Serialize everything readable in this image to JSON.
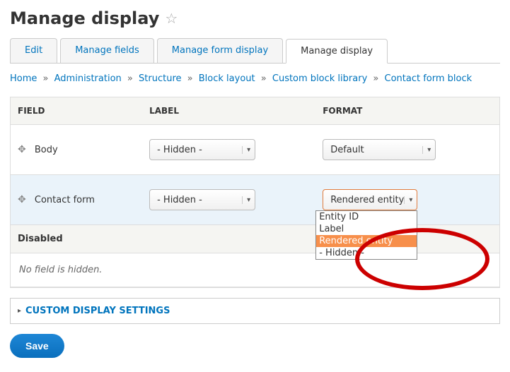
{
  "page": {
    "title": "Manage display"
  },
  "tabs": [
    {
      "label": "Edit"
    },
    {
      "label": "Manage fields"
    },
    {
      "label": "Manage form display"
    },
    {
      "label": "Manage display"
    }
  ],
  "breadcrumb": {
    "items": [
      "Home",
      "Administration",
      "Structure",
      "Block layout",
      "Custom block library",
      "Contact form block"
    ],
    "sep": "»"
  },
  "table": {
    "headers": {
      "field": "FIELD",
      "label": "LABEL",
      "format": "FORMAT"
    },
    "rows": [
      {
        "field": "Body",
        "label_select": "- Hidden -",
        "format_select": "Default"
      },
      {
        "field": "Contact form",
        "label_select": "- Hidden -",
        "format_select": "Rendered entity"
      }
    ]
  },
  "dropdown": {
    "options": [
      "Entity ID",
      "Label",
      "Rendered entity",
      "- Hidden -"
    ]
  },
  "disabled": {
    "header": "Disabled",
    "body": "No field is hidden."
  },
  "custom_settings": {
    "label": "CUSTOM DISPLAY SETTINGS"
  },
  "save": {
    "label": "Save"
  }
}
